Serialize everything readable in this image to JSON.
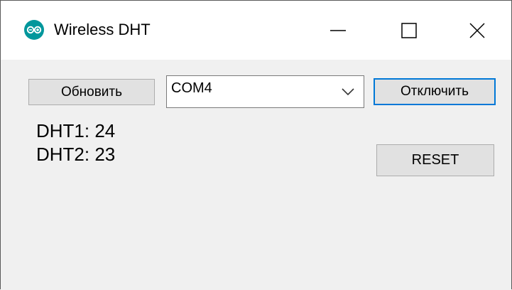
{
  "window": {
    "title": "Wireless DHT",
    "icon": "arduino-icon",
    "accent_color": "#00979c"
  },
  "toolbar": {
    "refresh_label": "Обновить",
    "port_value": "COM4",
    "disconnect_label": "Отключить",
    "reset_label": "RESET"
  },
  "readings": {
    "dht1": "DHT1: 24",
    "dht2": "DHT2: 23"
  },
  "colors": {
    "focus_border": "#0078d7",
    "button_face": "#e1e1e1",
    "background": "#f0f0f0"
  }
}
